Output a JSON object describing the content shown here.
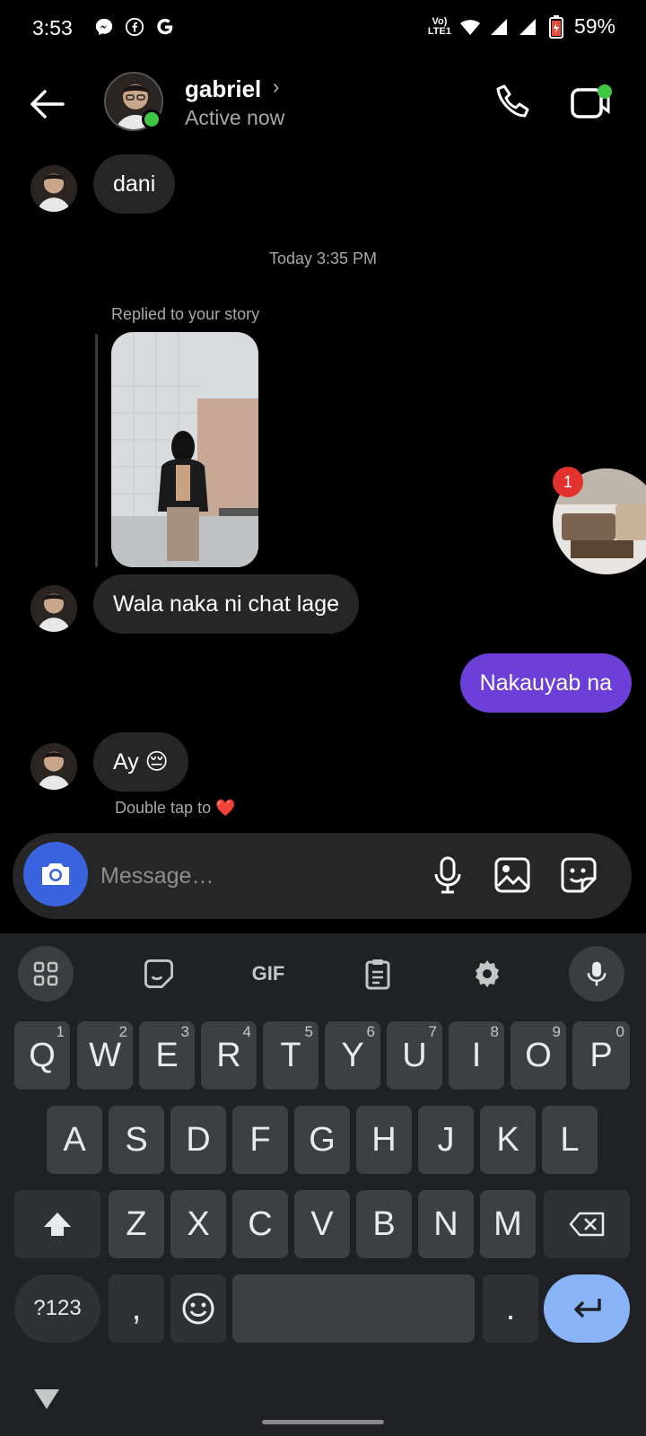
{
  "status_bar": {
    "time": "3:53",
    "battery": "59%",
    "network": "VoLTE1",
    "notification_icons": [
      "messenger-icon",
      "facebook-icon",
      "google-icon"
    ]
  },
  "header": {
    "name": "gabriel",
    "status": "Active now",
    "online_color": "#3ec745"
  },
  "messages": {
    "first": "dani",
    "timestamp": "Today 3:35 PM",
    "replied_label": "Replied to your story",
    "reply_text": "Wala naka ni chat lage",
    "outgoing": "Nakauyab na",
    "last": "Ay 😔",
    "double_tap_hint": "Double tap to ❤️"
  },
  "chat_head": {
    "badge_count": "1"
  },
  "composer": {
    "placeholder": "Message…"
  },
  "keyboard": {
    "toolbar_gif": "GIF",
    "row1": [
      {
        "letter": "Q",
        "num": "1"
      },
      {
        "letter": "W",
        "num": "2"
      },
      {
        "letter": "E",
        "num": "3"
      },
      {
        "letter": "R",
        "num": "4"
      },
      {
        "letter": "T",
        "num": "5"
      },
      {
        "letter": "Y",
        "num": "6"
      },
      {
        "letter": "U",
        "num": "7"
      },
      {
        "letter": "I",
        "num": "8"
      },
      {
        "letter": "O",
        "num": "9"
      },
      {
        "letter": "P",
        "num": "0"
      }
    ],
    "row2": [
      "A",
      "S",
      "D",
      "F",
      "G",
      "H",
      "J",
      "K",
      "L"
    ],
    "row3": [
      "Z",
      "X",
      "C",
      "V",
      "B",
      "N",
      "M"
    ],
    "symbols": "?123",
    "comma": ",",
    "period": "."
  },
  "colors": {
    "outgoing_bubble": "#6c3fd8",
    "incoming_bubble": "#262626",
    "camera_button": "#3a63e0",
    "enter_key": "#8ab4f8",
    "badge": "#e3322d"
  }
}
